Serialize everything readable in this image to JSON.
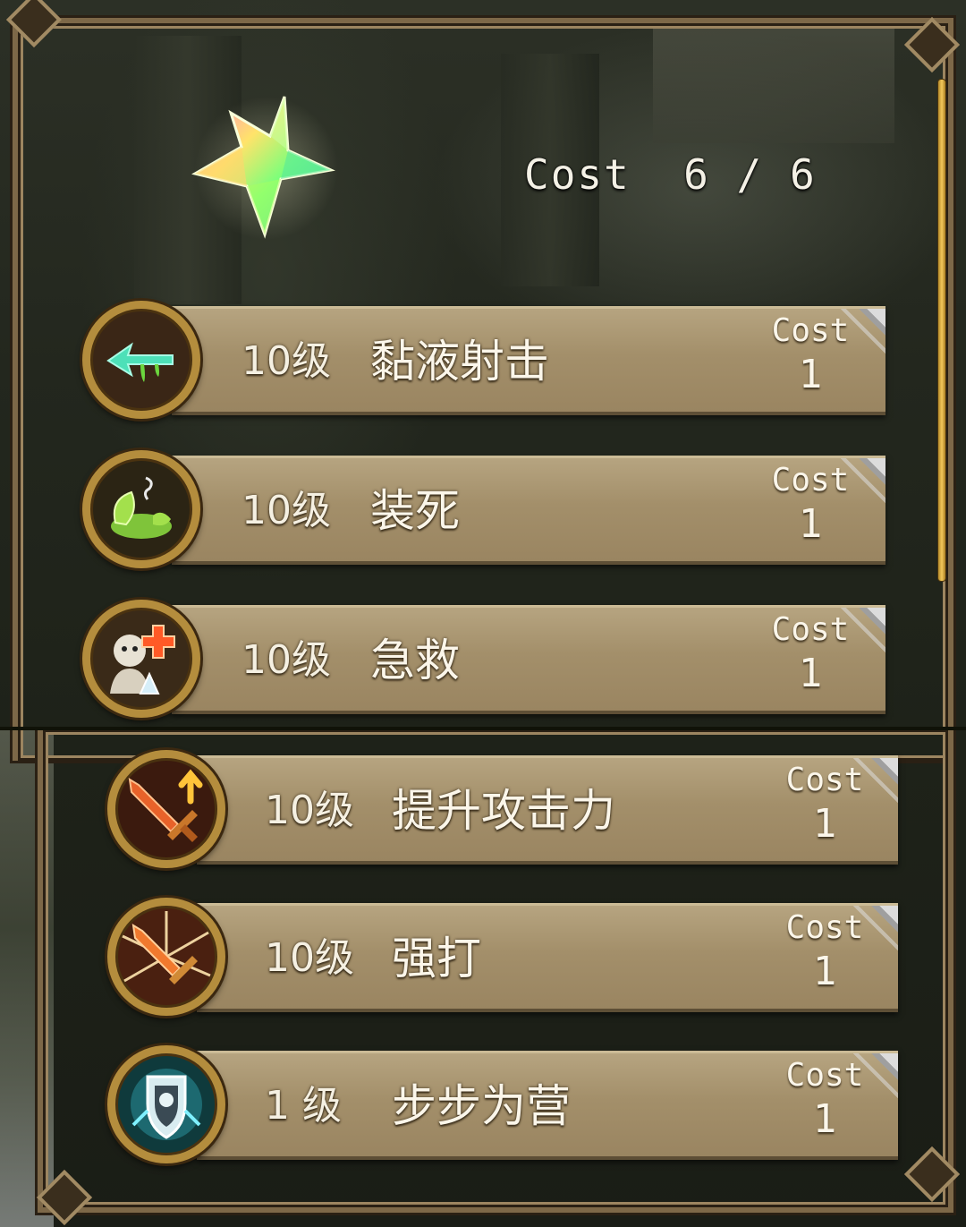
{
  "header": {
    "cost_text": "Cost  6 / 6",
    "gem_icon": "rainbow-star-gem-icon"
  },
  "skills": [
    {
      "level": "10级",
      "name": "黏液射击",
      "cost_label": "Cost",
      "cost_value": "1",
      "icon": "slime-arrow-icon"
    },
    {
      "level": "10级",
      "name": "装死",
      "cost_label": "Cost",
      "cost_value": "1",
      "icon": "slime-play-dead-icon"
    },
    {
      "level": "10级",
      "name": "急救",
      "cost_label": "Cost",
      "cost_value": "1",
      "icon": "first-aid-icon"
    },
    {
      "level": "10级",
      "name": "提升攻击力",
      "cost_label": "Cost",
      "cost_value": "1",
      "icon": "sword-attack-up-icon"
    },
    {
      "level": "10级",
      "name": "强打",
      "cost_label": "Cost",
      "cost_value": "1",
      "icon": "sword-bash-icon"
    },
    {
      "level": "1 级",
      "name": "步步为营",
      "cost_label": "Cost",
      "cost_value": "1",
      "icon": "shield-knight-icon"
    }
  ],
  "colors": {
    "bar": "#a38f6a",
    "frame": "#7d6848",
    "icon_ring": "#b48d3d",
    "scrollbar": "#f3c85a"
  }
}
